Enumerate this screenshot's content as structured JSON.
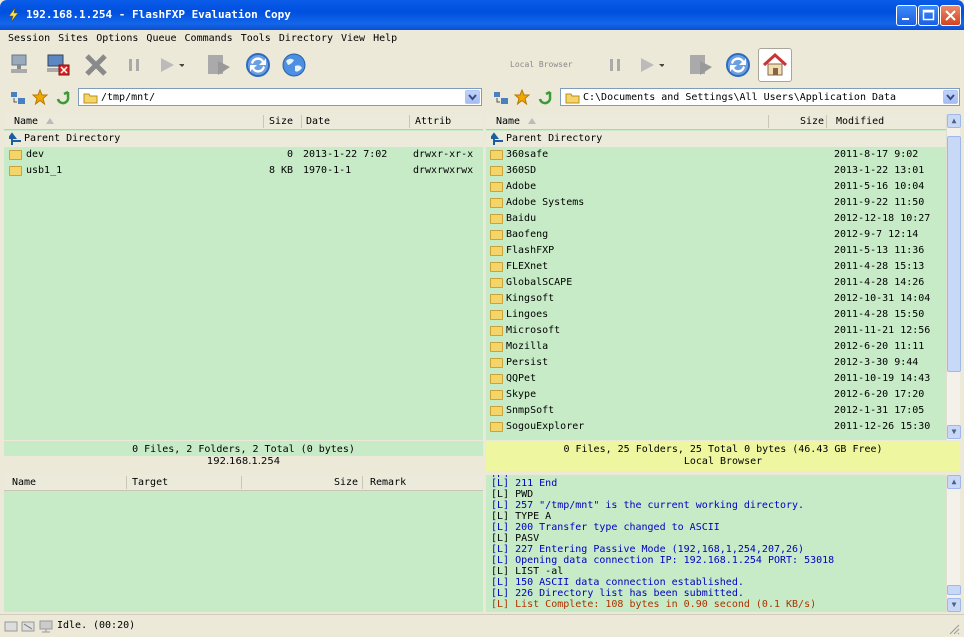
{
  "window": {
    "title": "192.168.1.254 - FlashFXP Evaluation Copy"
  },
  "menu": [
    "Session",
    "Sites",
    "Options",
    "Queue",
    "Commands",
    "Tools",
    "Directory",
    "View",
    "Help"
  ],
  "right_toolbar": {
    "local_browser_label": "Local Browser"
  },
  "left_panel": {
    "path": "/tmp/mnt/",
    "columns": {
      "name": "Name",
      "size": "Size",
      "date": "Date",
      "attrib": "Attrib"
    },
    "parent": "Parent Directory",
    "rows": [
      {
        "name": "dev",
        "size": "0",
        "date": "2013-1-22 7:02",
        "attrib": "drwxr-xr-x"
      },
      {
        "name": "usb1_1",
        "size": "8 KB",
        "date": "1970-1-1",
        "attrib": "drwxrwxrwx"
      }
    ],
    "summary": "0 Files, 2 Folders, 2 Total (0 bytes)",
    "host": "192.168.1.254"
  },
  "right_panel": {
    "path": "C:\\Documents and Settings\\All Users\\Application Data",
    "columns": {
      "name": "Name",
      "size": "Size",
      "modified": "Modified"
    },
    "parent": "Parent Directory",
    "rows": [
      {
        "name": "360safe",
        "modified": "2011-8-17 9:02"
      },
      {
        "name": "360SD",
        "modified": "2013-1-22 13:01"
      },
      {
        "name": "Adobe",
        "modified": "2011-5-16 10:04"
      },
      {
        "name": "Adobe Systems",
        "modified": "2011-9-22 11:50"
      },
      {
        "name": "Baidu",
        "modified": "2012-12-18 10:27"
      },
      {
        "name": "Baofeng",
        "modified": "2012-9-7 12:14"
      },
      {
        "name": "FlashFXP",
        "modified": "2011-5-13 11:36"
      },
      {
        "name": "FLEXnet",
        "modified": "2011-4-28 15:13"
      },
      {
        "name": "GlobalSCAPE",
        "modified": "2011-4-28 14:26"
      },
      {
        "name": "Kingsoft",
        "modified": "2012-10-31 14:04"
      },
      {
        "name": "Lingoes",
        "modified": "2011-4-28 15:50"
      },
      {
        "name": "Microsoft",
        "modified": "2011-11-21 12:56"
      },
      {
        "name": "Mozilla",
        "modified": "2012-6-20 11:11"
      },
      {
        "name": "Persist",
        "modified": "2012-3-30 9:44"
      },
      {
        "name": "QQPet",
        "modified": "2011-10-19 14:43"
      },
      {
        "name": "Skype",
        "modified": "2012-6-20 17:20"
      },
      {
        "name": "SnmpSoft",
        "modified": "2012-1-31 17:05"
      },
      {
        "name": "SogouExplorer",
        "modified": "2011-12-26 15:30"
      }
    ],
    "summary": "0 Files, 25 Folders, 25 Total 0 bytes (46.43 GB Free)",
    "label": "Local Browser"
  },
  "queue": {
    "columns": {
      "name": "Name",
      "target": "Target",
      "size": "Size",
      "remark": "Remark"
    }
  },
  "log": [
    {
      "text": "[L] 211 End",
      "color": "#0000c0"
    },
    {
      "text": "[L] PWD",
      "color": "#000000"
    },
    {
      "text": "[L] 257 \"/tmp/mnt\" is the current working directory.",
      "color": "#0000c0"
    },
    {
      "text": "[L] TYPE A",
      "color": "#000000"
    },
    {
      "text": "[L] 200 Transfer type changed to ASCII",
      "color": "#0000c0"
    },
    {
      "text": "[L] PASV",
      "color": "#000000"
    },
    {
      "text": "[L] 227 Entering Passive Mode (192,168,1,254,207,26)",
      "color": "#0000c0"
    },
    {
      "text": "[L] Opening data connection IP: 192.168.1.254 PORT: 53018",
      "color": "#0000c0"
    },
    {
      "text": "[L] LIST -al",
      "color": "#000000"
    },
    {
      "text": "[L] 150 ASCII data connection established.",
      "color": "#0000c0"
    },
    {
      "text": "[L] 226 Directory list has been submitted.",
      "color": "#0000c0"
    },
    {
      "text": "[L] List Complete: 108 bytes in 0.90 second (0.1 KB/s)",
      "color": "#b03000"
    }
  ],
  "status": {
    "text": "Idle.",
    "time": "(00:20)"
  },
  "colors": {
    "list_bg": "#c7ebc7",
    "right_status_bg": "#eef7a0",
    "title_blue": "#0a5ce8"
  }
}
